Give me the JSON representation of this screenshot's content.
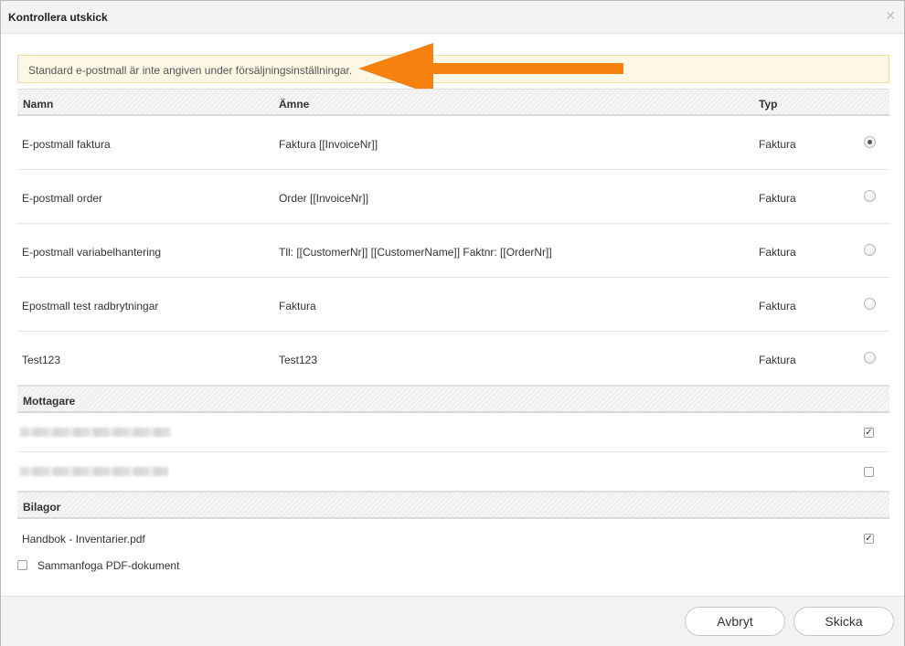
{
  "dialog": {
    "title": "Kontrollera utskick"
  },
  "warning": {
    "text": "Standard e-postmall är inte angiven under försäljningsinställningar."
  },
  "templates": {
    "headers": {
      "name": "Namn",
      "subject": "Ämne",
      "type": "Typ"
    },
    "rows": [
      {
        "name": "E-postmall faktura",
        "subject": "Faktura [[InvoiceNr]]",
        "type": "Faktura",
        "selected": true
      },
      {
        "name": "E-postmall order",
        "subject": "Order [[InvoiceNr]]",
        "type": "Faktura",
        "selected": false
      },
      {
        "name": "E-postmall variabelhantering",
        "subject": "Tll: [[CustomerNr]] [[CustomerName]] Faktnr: [[OrderNr]]",
        "type": "Faktura",
        "selected": false
      },
      {
        "name": "Epostmall test radbrytningar",
        "subject": "Faktura",
        "type": "Faktura",
        "selected": false
      },
      {
        "name": "Test123",
        "subject": "Test123",
        "type": "Faktura",
        "selected": false
      }
    ]
  },
  "recipients": {
    "header": "Mottagare",
    "rows": [
      {
        "checked": true
      },
      {
        "checked": false
      }
    ]
  },
  "attachments": {
    "header": "Bilagor",
    "file": {
      "name": "Handbok - Inventarier.pdf",
      "checked": true
    },
    "merge_label": "Sammanfoga PDF-dokument",
    "merge_checked": false
  },
  "buttons": {
    "cancel": "Avbryt",
    "send": "Skicka"
  },
  "colors": {
    "arrow": "#f7810e",
    "warning_bg": "#fcf8e3"
  }
}
